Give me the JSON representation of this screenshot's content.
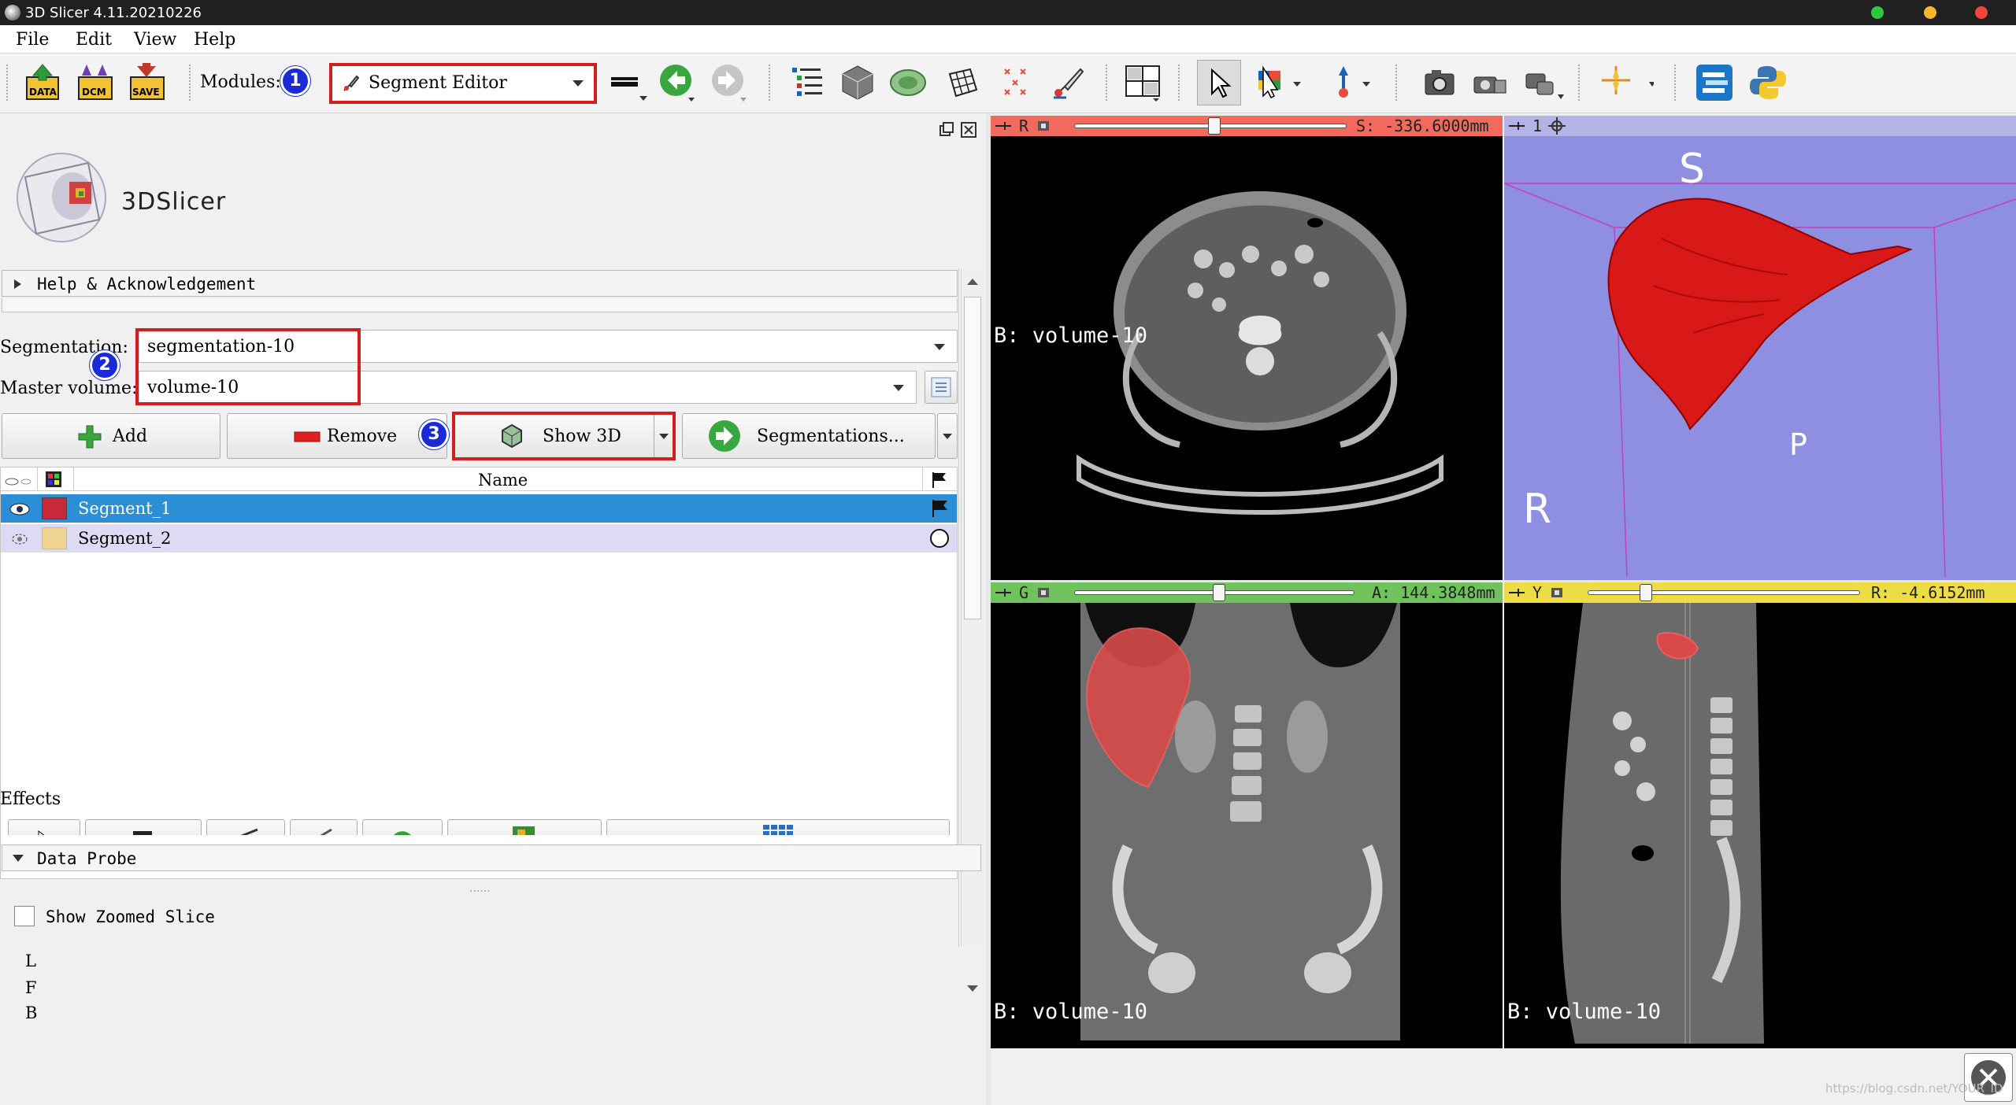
{
  "window": {
    "title": "3D Slicer 4.11.20210226"
  },
  "menu": {
    "file": "File",
    "edit": "Edit",
    "view": "View",
    "help": "Help"
  },
  "toolbar": {
    "data_label": "DATA",
    "dcm_label": "DCM",
    "save_label": "SAVE",
    "modules_label": "Modules:",
    "module_selected": "Segment Editor"
  },
  "annotations": {
    "step1": "1",
    "step2": "2",
    "step3": "3"
  },
  "logo": {
    "text": "3DSlicer"
  },
  "panel": {
    "help_section": "Help & Acknowledgement",
    "segmentation_label": "Segmentation:",
    "segmentation_value": "segmentation-10",
    "master_volume_label": "Master volume:",
    "master_volume_value": "volume-10",
    "add_button": "Add",
    "remove_button": "Remove",
    "show3d_button": "Show 3D",
    "segmentations_button": "Segmentations...",
    "table_name_header": "Name",
    "segments": [
      {
        "name": "Segment_1",
        "color": "#c7283a",
        "selected": true
      },
      {
        "name": "Segment_2",
        "color": "#f0d591",
        "selected": false
      }
    ],
    "effects_label": "Effects",
    "data_probe_section": "Data Probe",
    "show_zoomed_slice": "Show Zoomed Slice",
    "probe_L": "L",
    "probe_F": "F",
    "probe_B": "B"
  },
  "views": {
    "red": {
      "letter": "R",
      "offset": "S: -336.6000mm",
      "background": "B: volume-10",
      "color": "#f26a5e"
    },
    "threeD": {
      "index": "1",
      "label_S": "S",
      "label_P": "P",
      "label_R": "R",
      "background_color": "#8e8fe0"
    },
    "green": {
      "letter": "G",
      "offset": "A: 144.3848mm",
      "background": "B: volume-10",
      "color": "#6fc25c"
    },
    "yellow": {
      "letter": "Y",
      "offset": "R: -4.6152mm",
      "background": "B: volume-10",
      "color": "#eddc43"
    }
  },
  "watermark": "https://blog.csdn.net/YOUR_ID"
}
